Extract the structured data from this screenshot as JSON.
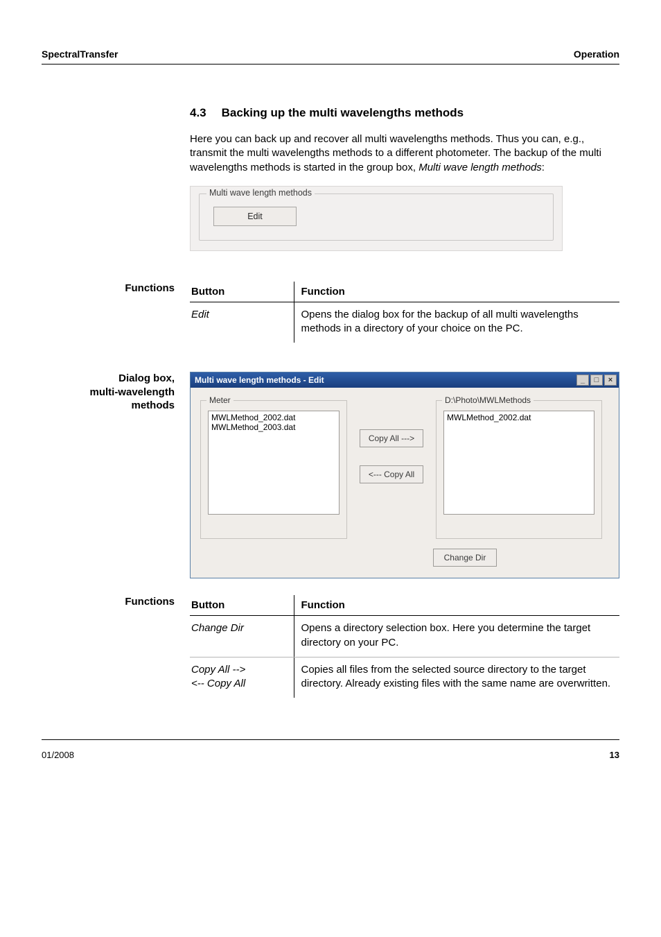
{
  "header": {
    "left": "SpectralTransfer",
    "right": "Operation"
  },
  "section": {
    "number": "4.3",
    "title": "Backing up the multi wavelengths methods"
  },
  "intro": {
    "p1": "Here you can back up and recover all multi wavelengths methods. Thus you can, e.g., transmit the multi wavelengths methods to a different photometer. The backup of the multi wavelengths methods is started in the group box, ",
    "p1_em": "Multi wave length methods",
    "p1_tail": ":"
  },
  "groupbox": {
    "title": "Multi wave length methods",
    "edit": "Edit"
  },
  "sidebars": {
    "functions": "Functions",
    "dialogbox_l1": "Dialog box,",
    "dialogbox_l2": "multi-wavelength",
    "dialogbox_l3": "methods"
  },
  "table1": {
    "h_button": "Button",
    "h_function": "Function",
    "r1_btn": "Edit",
    "r1_fn": "Opens the dialog box for the backup of all multi wavelengths methods in a directory of your choice on the PC."
  },
  "dialog": {
    "title": "Multi wave length methods - Edit",
    "meter_group": "Meter",
    "meter_items": [
      "MWLMethod_2002.dat",
      "MWLMethod_2003.dat"
    ],
    "copy_all_right": "Copy All --->",
    "copy_all_left": "<--- Copy All",
    "right_group": "D:\\Photo\\MWLMethods",
    "right_items": [
      "MWLMethod_2002.dat"
    ],
    "change_dir": "Change Dir"
  },
  "table2": {
    "h_button": "Button",
    "h_function": "Function",
    "r1_btn": "Change Dir",
    "r1_fn": "Opens a directory selection box. Here you determine the target directory on your PC.",
    "r2_btn_l1": "Copy All -->",
    "r2_btn_l2": "<-- Copy All",
    "r2_fn": "Copies all files from the selected source directory to the target directory. Already existing files with the same name are overwritten."
  },
  "footer": {
    "date": "01/2008",
    "page": "13"
  }
}
